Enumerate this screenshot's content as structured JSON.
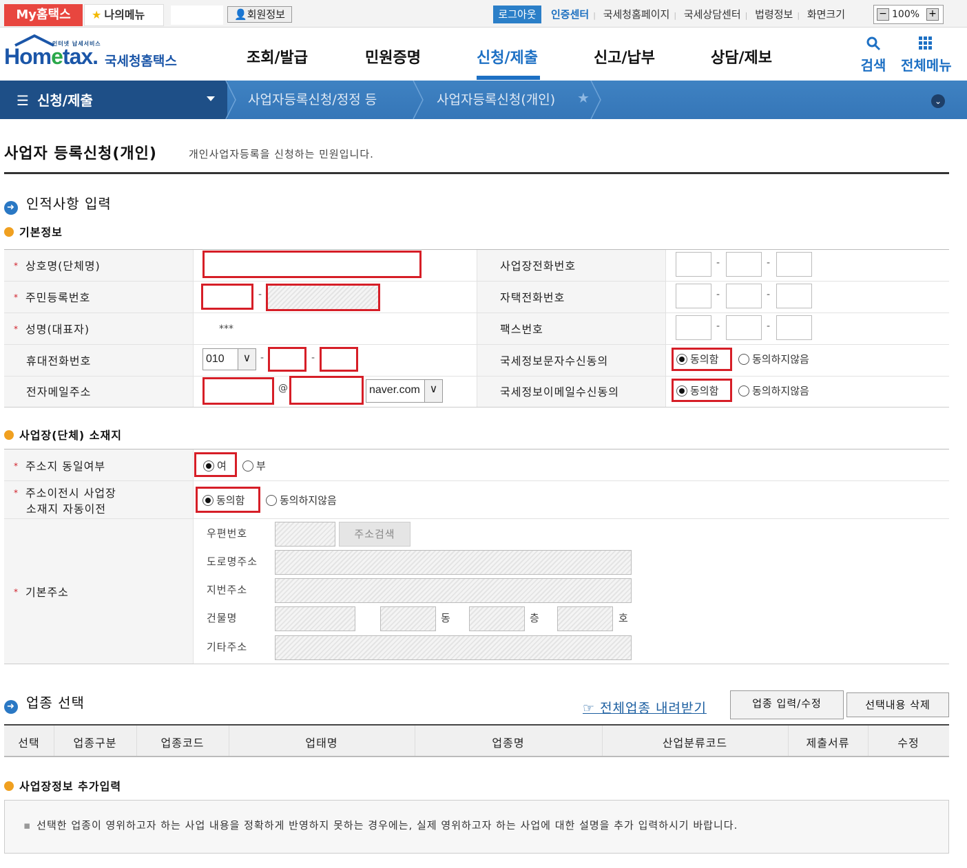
{
  "topbar": {
    "myhometax": "My홈택스",
    "mymenu": "나의메뉴",
    "member_info": "회원정보",
    "logout": "로그아웃",
    "links": [
      "인증센터",
      "국세청홈페이지",
      "국세상담센터",
      "법령정보",
      "화면크기"
    ],
    "zoom": "100%"
  },
  "header": {
    "logo_sub": "인터넷 납세서비스",
    "logo_text_a": "Hom",
    "logo_text_e": "e",
    "logo_text_b": "tax.",
    "logo_kr": "국세청홈택스",
    "nav": [
      "조회/발급",
      "민원증명",
      "신청/제출",
      "신고/납부",
      "상담/제보"
    ],
    "active_nav": "신청/제출",
    "search": "검색",
    "all_menu": "전체메뉴"
  },
  "breadcrumb": {
    "menu": "신청/제출",
    "items": [
      "사업자등록신청/정정 등",
      "사업자등록신청(개인)"
    ]
  },
  "page": {
    "title": "사업자 등록신청(개인)",
    "desc": "개인사업자등록을 신청하는 민원입니다."
  },
  "section1": {
    "title": "인적사항 입력",
    "sub_basic": "기본정보",
    "labels": {
      "company_name": "상호명(단체명)",
      "resident_no": "주민등록번호",
      "name": "성명(대표자)",
      "mobile": "휴대전화번호",
      "email": "전자메일주소",
      "biz_phone": "사업장전화번호",
      "home_phone": "자택전화번호",
      "fax": "팩스번호",
      "sms_consent": "국세정보문자수신동의",
      "email_consent": "국세정보이메일수신동의"
    },
    "name_value": "***",
    "mobile_prefix": "010",
    "email_domain": "naver.com",
    "at": "@",
    "agree": "동의함",
    "disagree": "동의하지않음"
  },
  "section_addr": {
    "title": "사업장(단체) 소재지",
    "same_addr_label": "주소지 동일여부",
    "yes": "여",
    "no": "부",
    "auto_move_label_1": "주소이전시 사업장",
    "auto_move_label_2": "소재지 자동이전",
    "agree": "동의함",
    "disagree": "동의하지않음",
    "basic_addr_label": "기본주소",
    "postal": "우편번호",
    "addr_search": "주소검색",
    "road_addr": "도로명주소",
    "lot_addr": "지번주소",
    "building": "건물명",
    "dong": "동",
    "floor": "층",
    "ho": "호",
    "etc_addr": "기타주소"
  },
  "section_ind": {
    "title": "업종 선택",
    "download": "☞ 전체업종 내려받기",
    "edit_btn": "업종 입력/수정",
    "delete_btn": "선택내용 삭제",
    "columns": [
      "선택",
      "업종구분",
      "업종코드",
      "업태명",
      "업종명",
      "산업분류코드",
      "제출서류",
      "수정"
    ]
  },
  "section_extra": {
    "title": "사업장정보 추가입력",
    "notice": "선택한 업종이 영위하고자 하는 사업 내용을 정확하게 반영하지 못하는 경우에는, 실제 영위하고자 하는 사업에 대한 설명을 추가 입력하시기 바랍니다."
  }
}
